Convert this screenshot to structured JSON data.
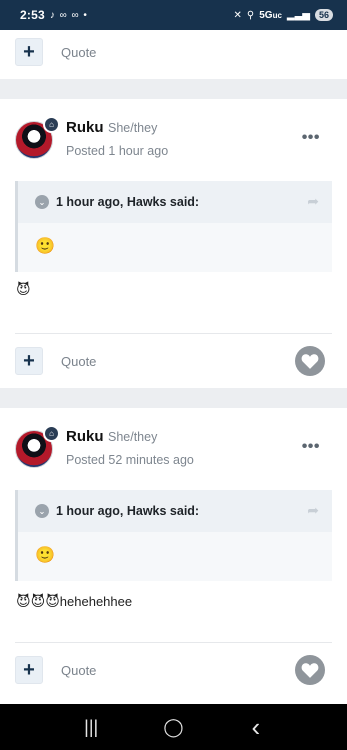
{
  "status_bar": {
    "time": "2:53",
    "app_icons": "♪ ∞ ∞ •",
    "network": "5G",
    "network_suffix": "uc",
    "battery": "56"
  },
  "top_card": {
    "quote_label": "Quote"
  },
  "posts": [
    {
      "author": "Ruku",
      "pronouns": "She/they",
      "posted": "Posted 1 hour ago",
      "quote_header": "1 hour ago, Hawks said:",
      "quote_emoji": "🙂",
      "message_emoji": "😈",
      "message_text": "",
      "quote_label": "Quote"
    },
    {
      "author": "Ruku",
      "pronouns": "She/they",
      "posted": "Posted 52 minutes ago",
      "quote_header": "1 hour ago, Hawks said:",
      "quote_emoji": "🙂",
      "message_emoji": "😈😈😈",
      "message_text": "hehehehhee",
      "quote_label": "Quote"
    }
  ],
  "nav": {
    "recents": "|||",
    "home": "◯",
    "back": "‹"
  },
  "colors": {
    "status_bar": "#17324d",
    "accent": "#17324d",
    "page_bg": "#eceef1"
  }
}
